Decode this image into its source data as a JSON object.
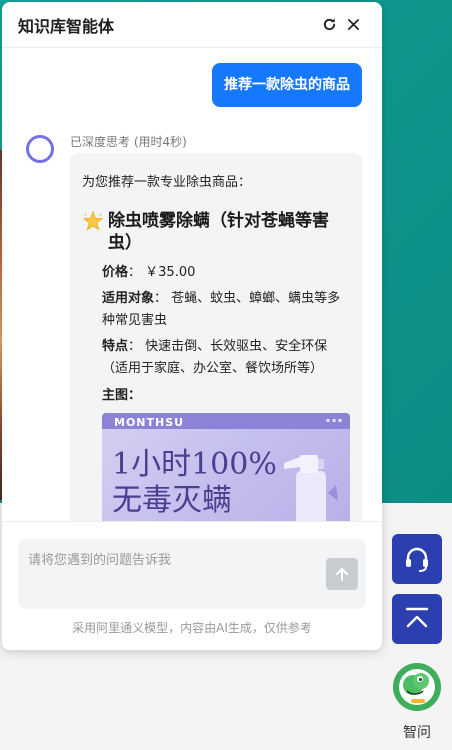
{
  "panel": {
    "title": "知识库智能体",
    "refresh_icon": "refresh-icon",
    "close_icon": "close-icon"
  },
  "conversation": {
    "user_message": "推荐一款除虫的商品",
    "think_status": "已深度思考 (用时4秒)",
    "bot_reply": {
      "intro": "为您推荐一款专业除虫商品：",
      "product_emoji": "sparkle-star-icon",
      "product_title": "除虫喷雾除螨（针对苍蝇等害虫）",
      "price_label": "价格",
      "price_value": "￥35.00",
      "targets_label": "适用对象",
      "targets_value": "苍蝇、蚊虫、蟑螂、螨虫等多种常见害虫",
      "features_label": "特点",
      "features_value": "快速击倒、长效驱虫、安全环保（适用于家庭、办公室、餐饮场所等）",
      "image_label": "主图",
      "image": {
        "brand": "MONTHSU",
        "headline_1": "1小时100%",
        "headline_2": "无毒灭螨"
      }
    }
  },
  "input": {
    "placeholder": "请将您遇到的问题告诉我",
    "send_icon": "arrow-up-icon",
    "disclaimer": "采用阿里通义模型，内容由AI生成，仅供参考"
  },
  "floating": {
    "service_icon": "headset-icon",
    "back_to_top_icon": "back-to-top-icon",
    "assistant_label": "智问"
  },
  "colors": {
    "accent": "#1677ff",
    "float_button": "#2b3fb0",
    "avatar_ring": "#7770e6",
    "background_teal": "#10968e"
  }
}
